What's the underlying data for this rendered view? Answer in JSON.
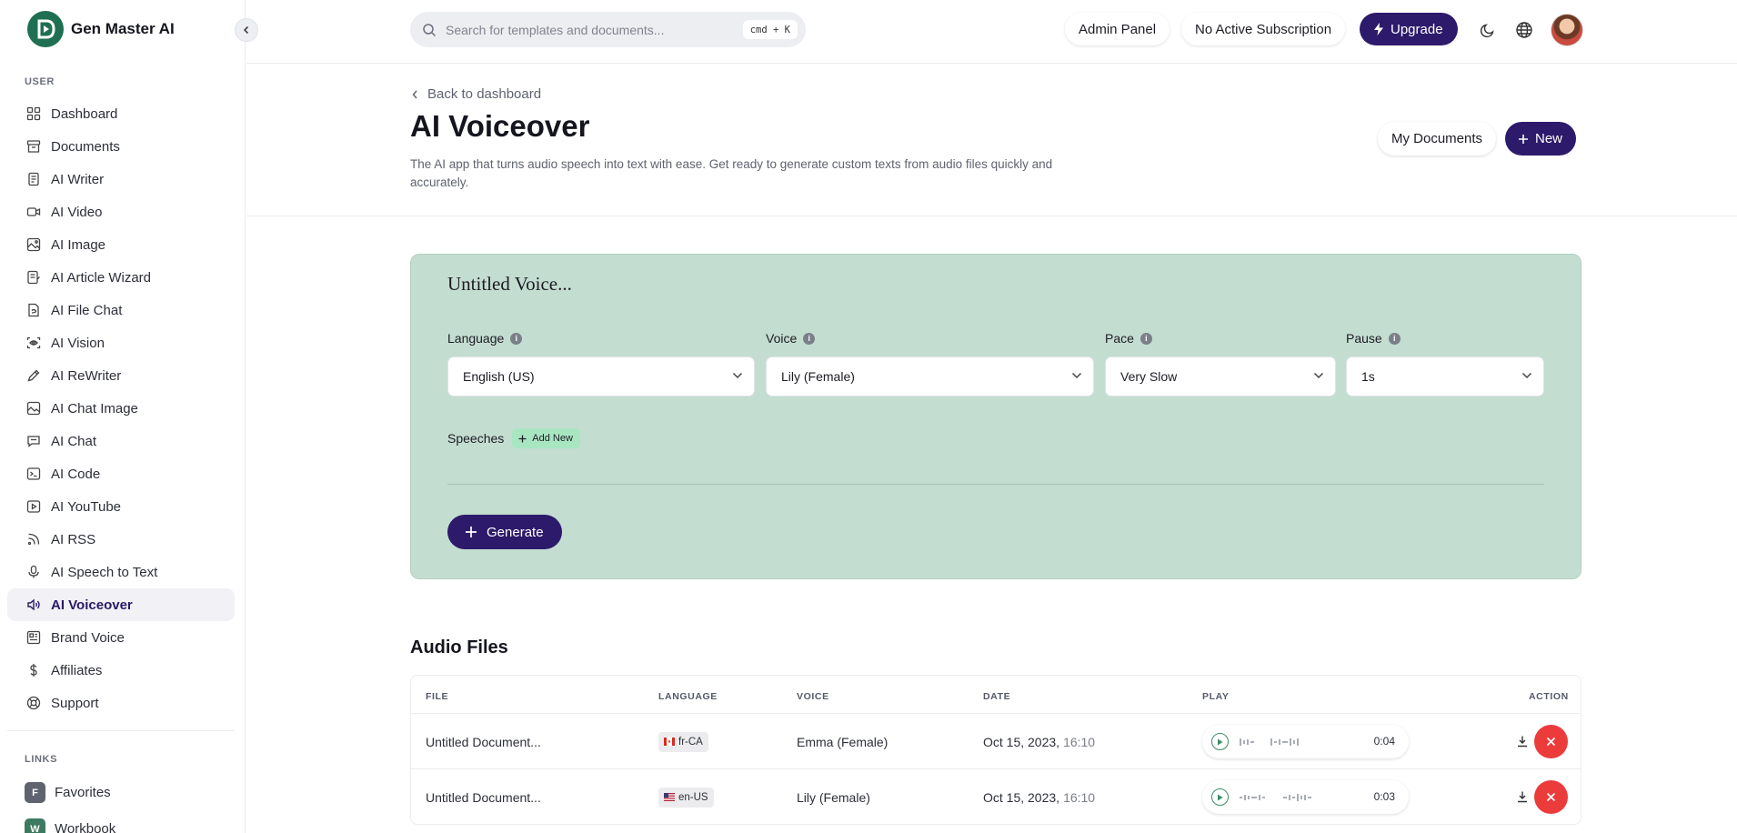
{
  "brand": {
    "name": "Gen Master AI",
    "logo_color": "#1f6f53"
  },
  "sidebar": {
    "section_user": "USER",
    "items": [
      {
        "label": "Dashboard",
        "icon": "dashboard-icon"
      },
      {
        "label": "Documents",
        "icon": "archive-icon"
      },
      {
        "label": "AI Writer",
        "icon": "document-icon"
      },
      {
        "label": "AI Video",
        "icon": "video-icon"
      },
      {
        "label": "AI Image",
        "icon": "image-icon"
      },
      {
        "label": "AI Article Wizard",
        "icon": "wizard-icon"
      },
      {
        "label": "AI File Chat",
        "icon": "file-chat-icon"
      },
      {
        "label": "AI Vision",
        "icon": "vision-icon"
      },
      {
        "label": "AI ReWriter",
        "icon": "pencil-icon"
      },
      {
        "label": "AI Chat Image",
        "icon": "chat-image-icon"
      },
      {
        "label": "AI Chat",
        "icon": "chat-icon"
      },
      {
        "label": "AI Code",
        "icon": "terminal-icon"
      },
      {
        "label": "AI YouTube",
        "icon": "youtube-icon"
      },
      {
        "label": "AI RSS",
        "icon": "rss-icon"
      },
      {
        "label": "AI Speech to Text",
        "icon": "microphone-icon"
      },
      {
        "label": "AI Voiceover",
        "icon": "speaker-icon",
        "active": true
      },
      {
        "label": "Brand Voice",
        "icon": "brand-icon"
      },
      {
        "label": "Affiliates",
        "icon": "dollar-icon"
      },
      {
        "label": "Support",
        "icon": "lifebuoy-icon"
      }
    ],
    "section_links": "LINKS",
    "links": [
      {
        "badge": "F",
        "label": "Favorites",
        "color": "#5f6370"
      },
      {
        "badge": "W",
        "label": "Workbook",
        "color": "#3d7a5f"
      }
    ]
  },
  "topbar": {
    "search_placeholder": "Search for templates and documents...",
    "shortcut": "cmd + K",
    "admin_panel": "Admin Panel",
    "subscription": "No Active Subscription",
    "upgrade": "Upgrade"
  },
  "header": {
    "back": "Back to dashboard",
    "title": "AI Voiceover",
    "description": "The AI app that turns audio speech into text with ease. Get ready to generate custom texts from audio files quickly and accurately.",
    "my_documents": "My Documents",
    "new": "New"
  },
  "form": {
    "title": "Untitled Voice...",
    "language_label": "Language",
    "language_value": "English (US)",
    "voice_label": "Voice",
    "voice_value": "Lily (Female)",
    "pace_label": "Pace",
    "pace_value": "Very Slow",
    "pause_label": "Pause",
    "pause_value": "1s",
    "speeches_label": "Speeches",
    "add_new": "Add New",
    "generate": "Generate",
    "card_color": "#c4ddd1"
  },
  "audio": {
    "title": "Audio Files",
    "columns": [
      "FILE",
      "LANGUAGE",
      "VOICE",
      "DATE",
      "PLAY",
      "ACTION"
    ],
    "rows": [
      {
        "file": "Untitled Document...",
        "lang": "fr-CA",
        "voice": "Emma (Female)",
        "date": "Oct 15, 2023,",
        "time": "16:10",
        "duration": "0:04"
      },
      {
        "file": "Untitled Document...",
        "lang": "en-US",
        "voice": "Lily (Female)",
        "date": "Oct 15, 2023,",
        "time": "16:10",
        "duration": "0:03"
      }
    ]
  },
  "colors": {
    "primary": "#2d1a6b",
    "danger": "#ec3b3b",
    "accent": "#3d8c66"
  }
}
